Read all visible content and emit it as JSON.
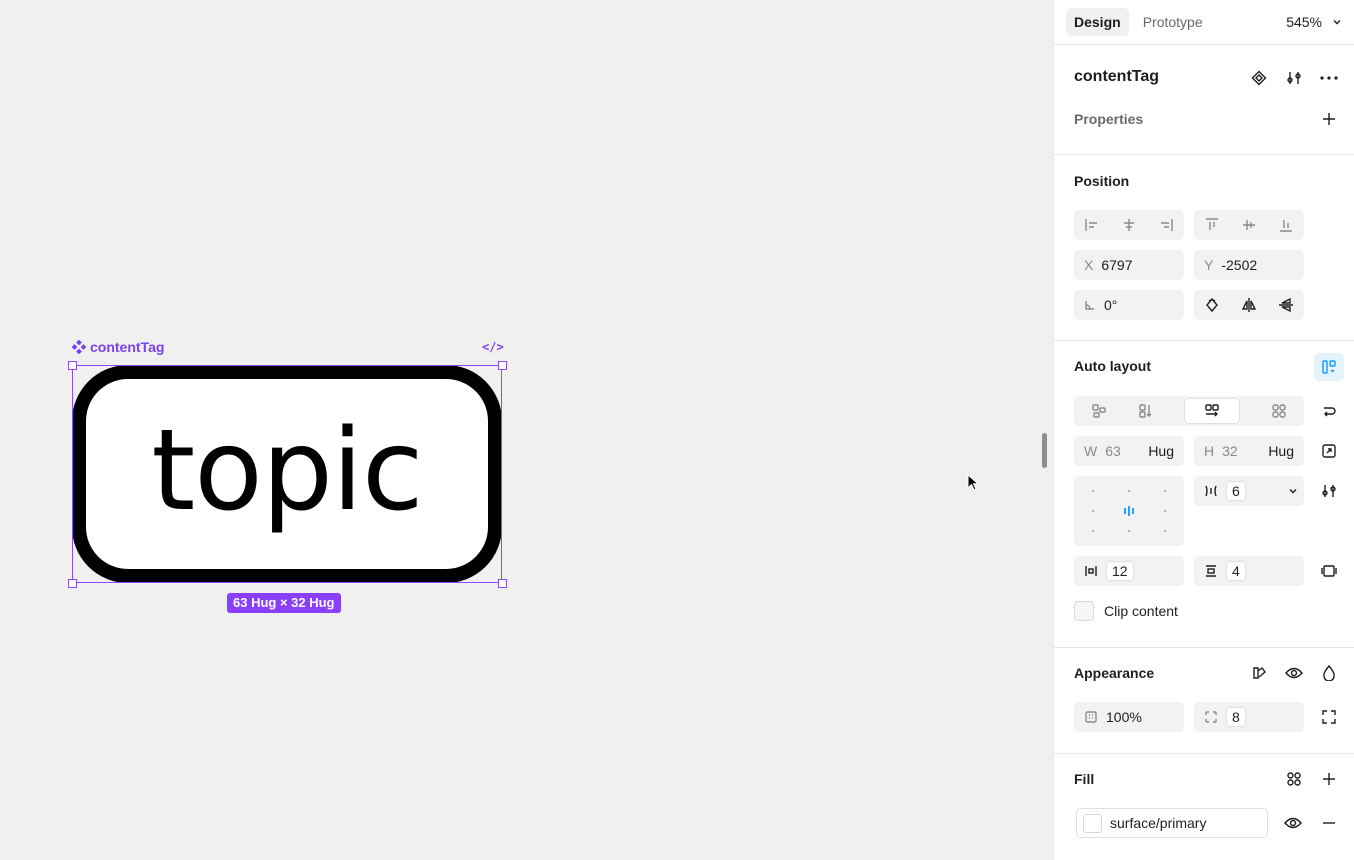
{
  "canvas": {
    "component_label": "contentTag",
    "code_icon": "</>",
    "tag_text": "topic",
    "size_badge": "63 Hug × 32 Hug"
  },
  "panel": {
    "tabs": [
      "Design",
      "Prototype"
    ],
    "zoom": "545%",
    "component": {
      "name": "contentTag",
      "properties_label": "Properties"
    },
    "position": {
      "title": "Position",
      "x_label": "X",
      "x_value": "6797",
      "y_label": "Y",
      "y_value": "-2502",
      "rotation": "0°"
    },
    "auto_layout": {
      "title": "Auto layout",
      "w_label": "W",
      "w_value": "63",
      "w_mode": "Hug",
      "h_label": "H",
      "h_value": "32",
      "h_mode": "Hug",
      "gap": "6",
      "padding_h": "12",
      "padding_v": "4",
      "clip_content": "Clip content"
    },
    "appearance": {
      "title": "Appearance",
      "opacity": "100%",
      "radius": "8"
    },
    "fill": {
      "title": "Fill",
      "style_name": "surface/primary"
    }
  },
  "colors": {
    "accent": "#8a3ffc",
    "selection": "#8a4dff",
    "blue": "#0d99ff"
  }
}
